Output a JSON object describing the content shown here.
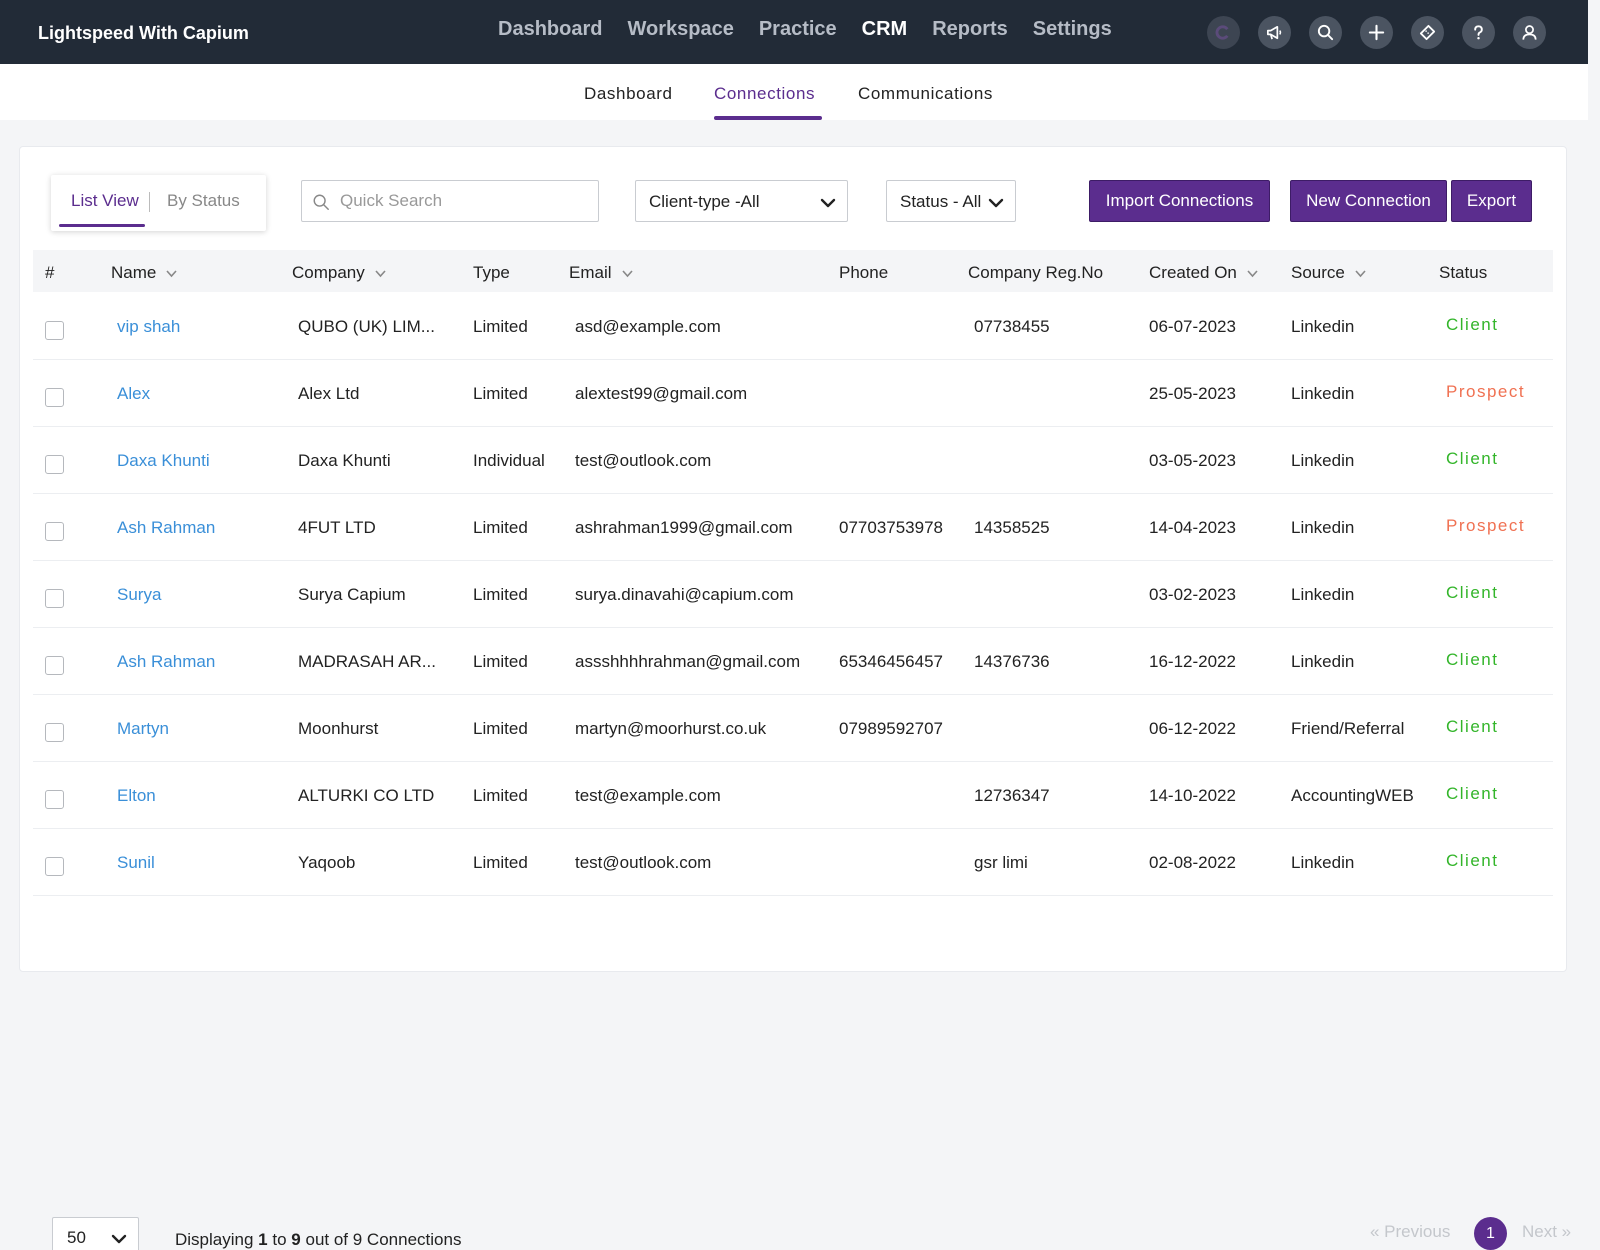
{
  "app": {
    "title": "Lightspeed With Capium"
  },
  "main_nav": [
    "Dashboard",
    "Workspace",
    "Practice",
    "CRM",
    "Reports",
    "Settings"
  ],
  "header_icons": [
    "capium-logo-icon",
    "megaphone-icon",
    "search-icon",
    "plus-icon",
    "ticket-icon",
    "help-icon",
    "user-icon"
  ],
  "sub_nav": [
    "Dashboard",
    "Connections",
    "Communications"
  ],
  "view_toggle": {
    "list": "List View",
    "status": "By Status"
  },
  "search": {
    "placeholder": "Quick Search"
  },
  "filters": {
    "client_type": "Client-type -All",
    "status": "Status - All"
  },
  "buttons": {
    "import": "Import Connections",
    "new": "New Connection",
    "export": "Export"
  },
  "table": {
    "headers": [
      "#",
      "Name",
      "Company",
      "Type",
      "Email",
      "Phone",
      "Company Reg.No",
      "Created On",
      "Source",
      "Status"
    ],
    "rows": [
      {
        "name": "vip shah",
        "company": "QUBO (UK) LIM...",
        "type": "Limited",
        "email": "asd@example.com",
        "phone": "",
        "reg": "07738455",
        "created": "06-07-2023",
        "source": "Linkedin",
        "status": "Client"
      },
      {
        "name": "Alex",
        "company": "Alex Ltd",
        "type": "Limited",
        "email": "alextest99@gmail.com",
        "phone": "",
        "reg": "",
        "created": "25-05-2023",
        "source": "Linkedin",
        "status": "Prospect"
      },
      {
        "name": "Daxa Khunti",
        "company": "Daxa Khunti",
        "type": "Individual",
        "email": "test@outlook.com",
        "phone": "",
        "reg": "",
        "created": "03-05-2023",
        "source": "Linkedin",
        "status": "Client"
      },
      {
        "name": "Ash Rahman",
        "company": "4FUT LTD",
        "type": "Limited",
        "email": "ashrahman1999@gmail.com",
        "phone": "07703753978",
        "reg": "14358525",
        "created": "14-04-2023",
        "source": "Linkedin",
        "status": "Prospect"
      },
      {
        "name": "Surya",
        "company": "Surya Capium",
        "type": "Limited",
        "email": "surya.dinavahi@capium.com",
        "phone": "",
        "reg": "",
        "created": "03-02-2023",
        "source": "Linkedin",
        "status": "Client"
      },
      {
        "name": "Ash Rahman",
        "company": "MADRASAH AR...",
        "type": "Limited",
        "email": "assshhhhrahman@gmail.com",
        "phone": "65346456457",
        "reg": "14376736",
        "created": "16-12-2022",
        "source": "Linkedin",
        "status": "Client"
      },
      {
        "name": "Martyn",
        "company": "Moonhurst",
        "type": "Limited",
        "email": "martyn@moorhurst.co.uk",
        "phone": "07989592707",
        "reg": "",
        "created": "06-12-2022",
        "source": "Friend/Referral",
        "status": "Client"
      },
      {
        "name": "Elton",
        "company": "ALTURKI CO LTD",
        "type": "Limited",
        "email": "test@example.com",
        "phone": "",
        "reg": "12736347",
        "created": "14-10-2022",
        "source": "AccountingWEB",
        "status": "Client"
      },
      {
        "name": "Sunil",
        "company": "Yaqoob",
        "type": "Limited",
        "email": "test@outlook.com",
        "phone": "",
        "reg": "gsr limi",
        "created": "02-08-2022",
        "source": "Linkedin",
        "status": "Client"
      }
    ]
  },
  "status_colors": {
    "Client": "#33b52a",
    "Prospect": "#f07152"
  },
  "accent_color": "#5b2d8e",
  "footer": {
    "per_page": "50",
    "display_prefix": "Displaying",
    "display_from": "1",
    "display_to_word": "to",
    "display_to": "9",
    "display_suffix": "out of 9 Connections",
    "previous": "« Previous",
    "next": "Next »",
    "current_page": "1"
  }
}
